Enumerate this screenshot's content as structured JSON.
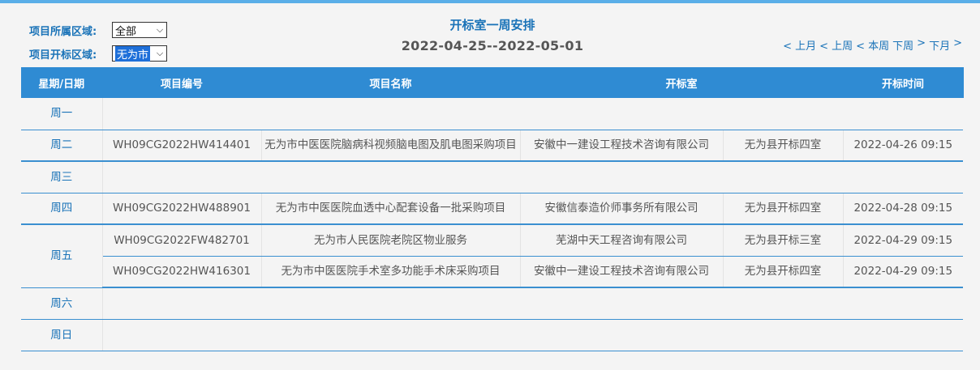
{
  "filters": {
    "region_label": "项目所属区域:",
    "region_value": "全部",
    "bid_region_label": "项目开标区域:",
    "bid_region_value": "无为市"
  },
  "header": {
    "title": "开标室一周安排",
    "date_range": "2022-04-25--2022-05-01"
  },
  "nav": {
    "prev_month": "< 上月",
    "prev_week": "< 上周",
    "this_week": "< 本周",
    "next_week": "下周",
    "next_month": "下月",
    "gt": ">"
  },
  "table": {
    "columns": [
      "星期/日期",
      "项目编号",
      "项目名称",
      "开标室",
      "开标时间"
    ],
    "days": {
      "mon": "周一",
      "tue": "周二",
      "wed": "周三",
      "thu": "周四",
      "fri": "周五",
      "sat": "周六",
      "sun": "周日"
    },
    "rows": [
      {
        "code": "WH09CG2022HW414401",
        "name": "无为市中医医院脑病科视频脑电图及肌电图采购项目",
        "agency": "安徽中一建设工程技术咨询有限公司",
        "room": "无为县开标四室",
        "time": "2022-04-26 09:15"
      },
      {
        "code": "WH09CG2022HW488901",
        "name": "无为市中医医院血透中心配套设备一批采购项目",
        "agency": "安徽信泰造价师事务所有限公司",
        "room": "无为县开标四室",
        "time": "2022-04-28 09:15"
      },
      {
        "code": "WH09CG2022FW482701",
        "name": "无为市人民医院老院区物业服务",
        "agency": "芜湖中天工程咨询有限公司",
        "room": "无为县开标三室",
        "time": "2022-04-29 09:15"
      },
      {
        "code": "WH09CG2022HW416301",
        "name": "无为市中医医院手术室多功能手术床采购项目",
        "agency": "安徽中一建设工程技术咨询有限公司",
        "room": "无为县开标四室",
        "time": "2022-04-29 09:15"
      }
    ]
  }
}
